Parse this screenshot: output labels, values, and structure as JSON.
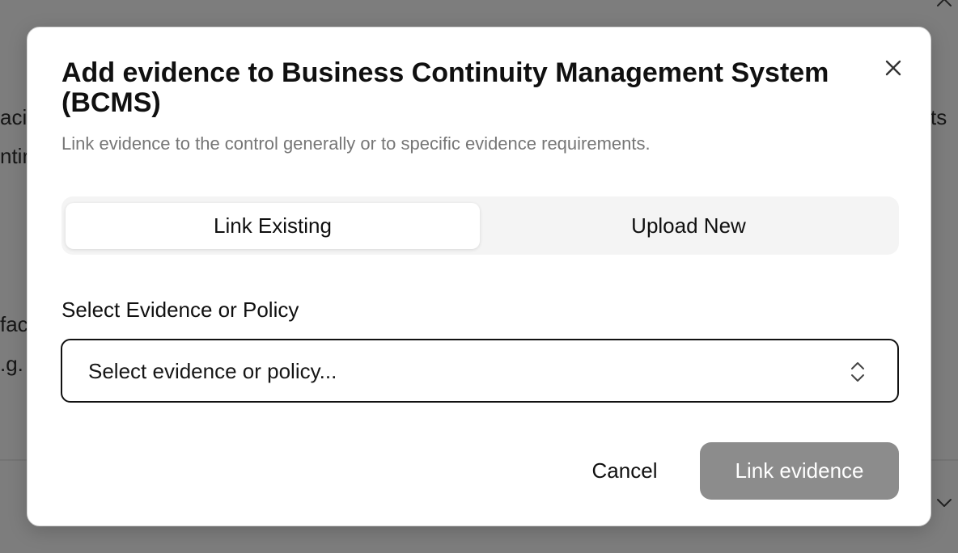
{
  "background": {
    "text_fragments": [
      "aci",
      "ntir",
      "fac",
      ".g.",
      "ts"
    ]
  },
  "modal": {
    "title": "Add evidence to Business Continuity Management System (BCMS)",
    "description": "Link evidence to the control generally or to specific evidence requirements.",
    "tabs": [
      {
        "label": "Link Existing",
        "active": true
      },
      {
        "label": "Upload New",
        "active": false
      }
    ],
    "field": {
      "label": "Select Evidence or Policy",
      "placeholder": "Select evidence or policy..."
    },
    "buttons": {
      "cancel": "Cancel",
      "primary": "Link evidence"
    }
  },
  "icons": {
    "close": "close-icon",
    "select": "chevron-up-down-icon",
    "bg_top": "chevron-up-icon",
    "bg_bottom": "chevron-down-icon"
  },
  "colors": {
    "overlay": "#7d7d7d",
    "primary_disabled": "#8c8c8c",
    "muted_text": "#767676",
    "tab_track": "#f4f4f4"
  }
}
